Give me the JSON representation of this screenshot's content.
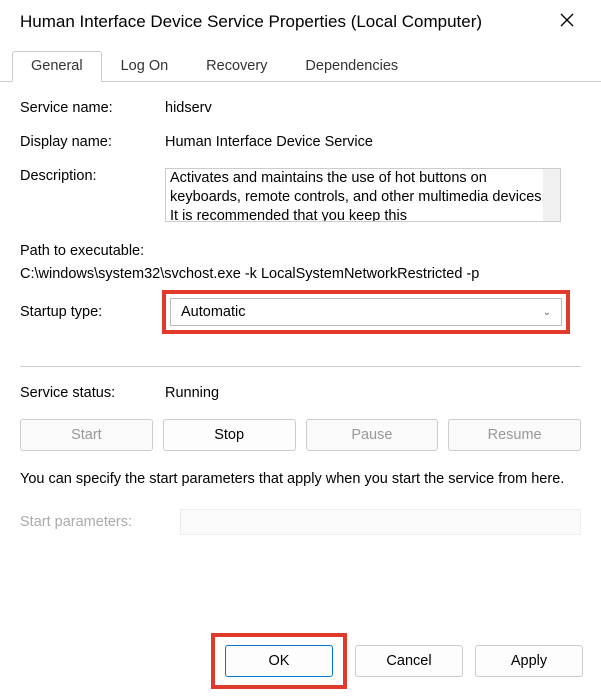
{
  "window": {
    "title": "Human Interface Device Service Properties (Local Computer)"
  },
  "tabs": {
    "general": "General",
    "logon": "Log On",
    "recovery": "Recovery",
    "dependencies": "Dependencies"
  },
  "labels": {
    "service_name": "Service name:",
    "display_name": "Display name:",
    "description": "Description:",
    "path": "Path to executable:",
    "startup_type": "Startup type:",
    "service_status": "Service status:",
    "start_params": "Start parameters:"
  },
  "values": {
    "service_name": "hidserv",
    "display_name": "Human Interface Device Service",
    "description": "Activates and maintains the use of hot buttons on keyboards, remote controls, and other multimedia devices. It is recommended that you keep this",
    "path": "C:\\windows\\system32\\svchost.exe -k LocalSystemNetworkRestricted -p",
    "startup_type": "Automatic",
    "service_status": "Running",
    "note": "You can specify the start parameters that apply when you start the service from here."
  },
  "buttons": {
    "start": "Start",
    "stop": "Stop",
    "pause": "Pause",
    "resume": "Resume",
    "ok": "OK",
    "cancel": "Cancel",
    "apply": "Apply"
  }
}
